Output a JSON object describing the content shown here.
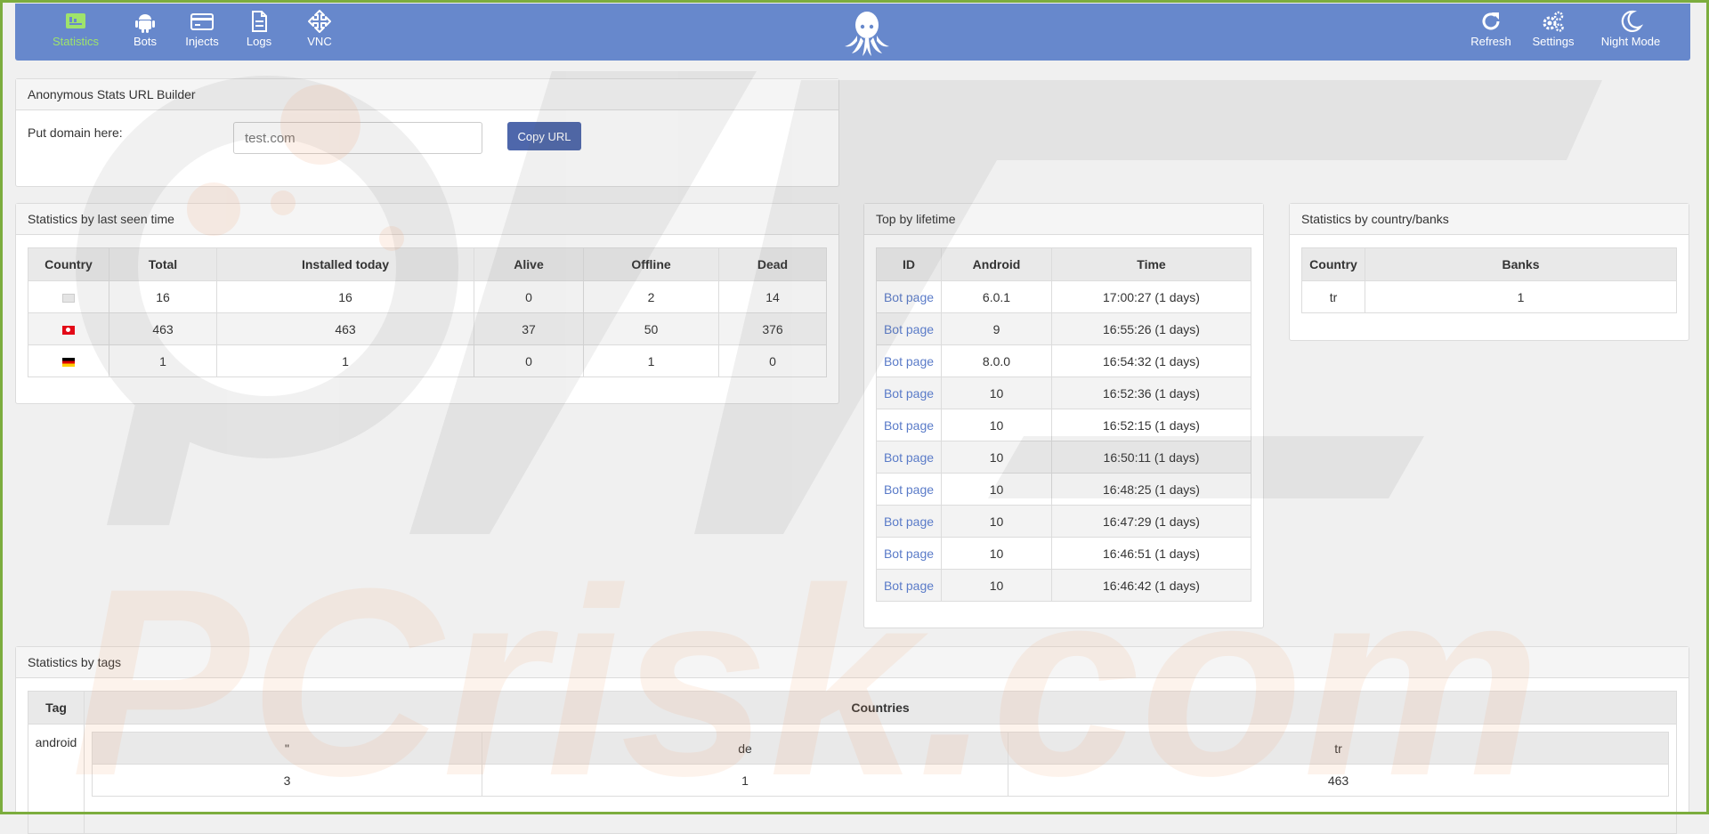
{
  "nav": {
    "left": [
      {
        "label": "Statistics",
        "icon": "statistics-icon",
        "active": true
      },
      {
        "label": "Bots",
        "icon": "android-icon"
      },
      {
        "label": "Injects",
        "icon": "card-icon"
      },
      {
        "label": "Logs",
        "icon": "document-icon"
      },
      {
        "label": "VNC",
        "icon": "move-arrows-icon"
      }
    ],
    "right": [
      {
        "label": "Refresh",
        "icon": "refresh-icon"
      },
      {
        "label": "Settings",
        "icon": "gears-icon"
      },
      {
        "label": "Night Mode",
        "icon": "moon-icon"
      }
    ],
    "logo": "octopus-logo"
  },
  "url_builder": {
    "title": "Anonymous Stats URL Builder",
    "label": "Put domain here:",
    "placeholder": "test.com",
    "button": "Copy URL"
  },
  "last_seen": {
    "title": "Statistics by last seen time",
    "headers": [
      "Country",
      "Total",
      "Installed today",
      "Alive",
      "Offline",
      "Dead"
    ],
    "rows": [
      {
        "flag": "unknown",
        "total": "16",
        "today": "16",
        "alive": "0",
        "offline": "2",
        "dead": "14"
      },
      {
        "flag": "tr",
        "total": "463",
        "today": "463",
        "alive": "37",
        "offline": "50",
        "dead": "376"
      },
      {
        "flag": "de",
        "total": "1",
        "today": "1",
        "alive": "0",
        "offline": "1",
        "dead": "0"
      }
    ]
  },
  "lifetime": {
    "title": "Top by lifetime",
    "headers": [
      "ID",
      "Android",
      "Time"
    ],
    "rows": [
      {
        "id": "Bot page",
        "android": "6.0.1",
        "time": "17:00:27 (1 days)"
      },
      {
        "id": "Bot page",
        "android": "9",
        "time": "16:55:26 (1 days)"
      },
      {
        "id": "Bot page",
        "android": "8.0.0",
        "time": "16:54:32 (1 days)"
      },
      {
        "id": "Bot page",
        "android": "10",
        "time": "16:52:36 (1 days)"
      },
      {
        "id": "Bot page",
        "android": "10",
        "time": "16:52:15 (1 days)"
      },
      {
        "id": "Bot page",
        "android": "10",
        "time": "16:50:11 (1 days)"
      },
      {
        "id": "Bot page",
        "android": "10",
        "time": "16:48:25 (1 days)"
      },
      {
        "id": "Bot page",
        "android": "10",
        "time": "16:47:29 (1 days)"
      },
      {
        "id": "Bot page",
        "android": "10",
        "time": "16:46:51 (1 days)"
      },
      {
        "id": "Bot page",
        "android": "10",
        "time": "16:46:42 (1 days)"
      }
    ]
  },
  "country_banks": {
    "title": "Statistics by country/banks",
    "headers": [
      "Country",
      "Banks"
    ],
    "rows": [
      {
        "country": "tr",
        "banks": "1"
      }
    ]
  },
  "tags": {
    "title": "Statistics by tags",
    "headers": [
      "Tag",
      "Countries"
    ],
    "tag": "android",
    "sub_headers": [
      "\"",
      "de",
      "tr"
    ],
    "sub_values": [
      "3",
      "1",
      "463"
    ]
  },
  "watermark": "PCrisk.com",
  "colors": {
    "navbar": "#6788cc",
    "active": "#9fe36b",
    "button": "#4e67ab",
    "link": "#5a7bc8",
    "frame": "#7cad3e"
  }
}
